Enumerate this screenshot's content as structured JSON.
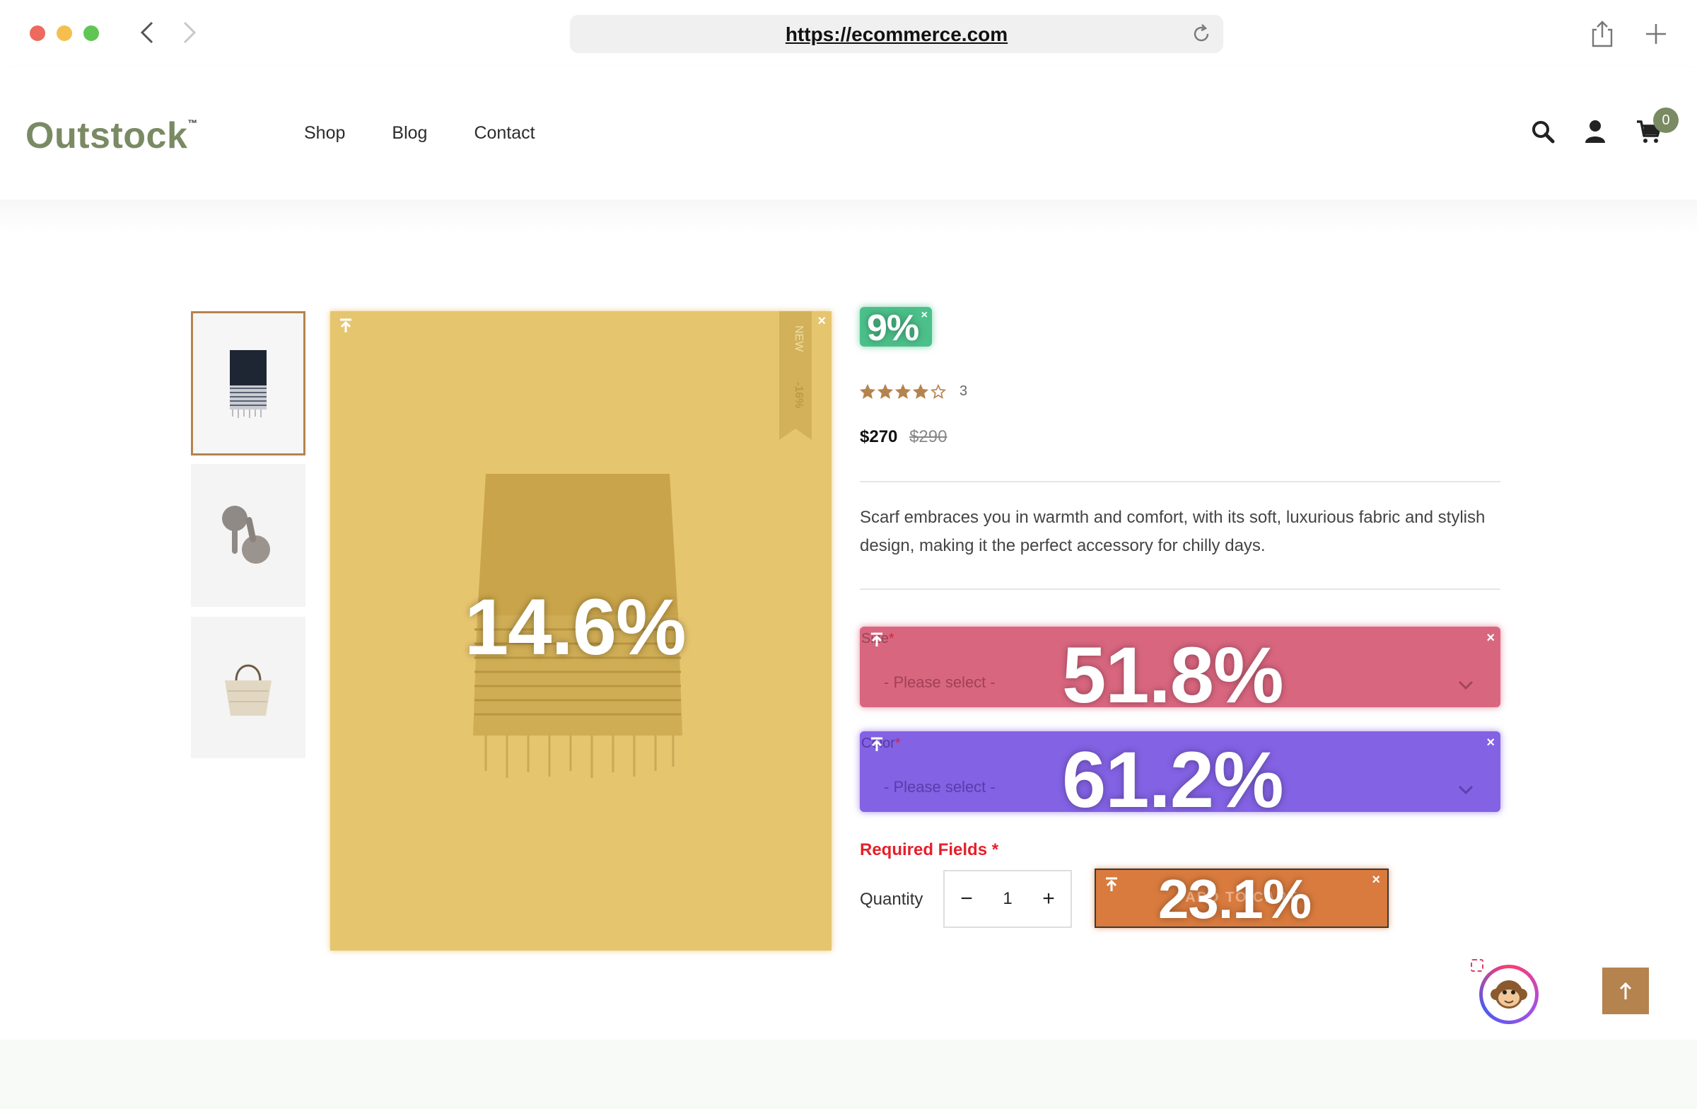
{
  "browser": {
    "url": "https://ecommerce.com"
  },
  "site": {
    "logo": "Outstock",
    "logo_mark": "™",
    "nav": [
      "Shop",
      "Blog",
      "Contact"
    ],
    "cart_count": "0"
  },
  "product": {
    "ribbon_new": "NEW",
    "ribbon_discount": "-16%",
    "rating": 4,
    "rating_max": 5,
    "review_count": "3",
    "price_now": "$270",
    "price_was": "$290",
    "description": "Scarf embraces you in warmth and comfort, with its soft, luxurious fabric and stylish design, making it the perfect accessory for chilly days.",
    "size": {
      "label": "Size",
      "required_mark": "*",
      "placeholder": "- Please select -"
    },
    "color": {
      "label": "Color",
      "required_mark": "*",
      "placeholder": "- Please select -"
    },
    "required_note": "Required Fields *",
    "quantity_label": "Quantity",
    "quantity_value": "1",
    "qty_minus": "−",
    "qty_plus": "+",
    "add_to_cart": "ADD TO CART"
  },
  "overlays": {
    "discount_badge": "9%",
    "main_image": "14.6%",
    "size_select": "51.8%",
    "color_select": "61.2%",
    "add_to_cart": "23.1%",
    "close_glyph": "×"
  },
  "colors": {
    "brand": "#7a8a63",
    "accent": "#b5834e",
    "required": "#e3212b",
    "overlay_main_image": "#e6c56f",
    "overlay_discount": "#4cc08a",
    "overlay_size": "#d9667f",
    "overlay_color": "#8362e4",
    "overlay_cart": "#d97b3e"
  },
  "icons": {
    "back": "chevron-left-icon",
    "forward": "chevron-right-icon",
    "reload": "reload-icon",
    "share": "share-icon",
    "new_tab": "plus-icon",
    "search": "search-icon",
    "account": "user-icon",
    "cart": "cart-icon",
    "chat": "monkey-chat-icon",
    "back_to_top": "arrow-up-icon"
  }
}
